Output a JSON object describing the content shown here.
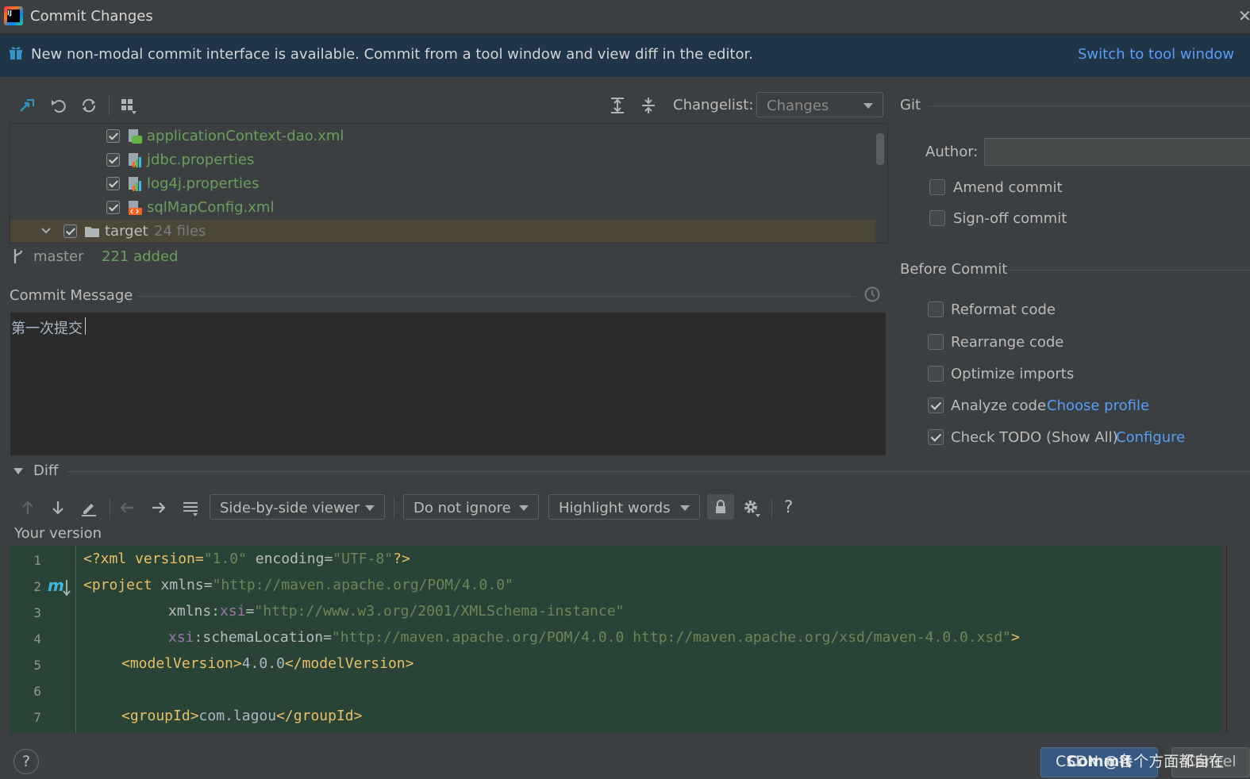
{
  "window": {
    "title": "Commit Changes"
  },
  "banner": {
    "text": "New non-modal commit interface is available. Commit from a tool window and view diff in the editor.",
    "link": "Switch to tool window"
  },
  "toolbar": {
    "changelist_label": "Changelist:",
    "changelist_value": "Changes"
  },
  "tree": {
    "files": [
      {
        "name": "applicationContext-dao.xml"
      },
      {
        "name": "jdbc.properties"
      },
      {
        "name": "log4j.properties"
      },
      {
        "name": "sqlMapConfig.xml"
      }
    ],
    "folder": {
      "name": "target",
      "count": "24 files"
    }
  },
  "status": {
    "branch": "master",
    "added": "221 added"
  },
  "commit_message": {
    "label": "Commit Message",
    "value": "第一次提交"
  },
  "git": {
    "title": "Git",
    "author_label": "Author:",
    "amend": "Amend commit",
    "signoff": "Sign-off commit"
  },
  "before_commit": {
    "title": "Before Commit",
    "reformat": "Reformat code",
    "rearrange": "Rearrange code",
    "optimize": "Optimize imports",
    "analyze": "Analyze code",
    "analyze_link": "Choose profile",
    "todo": "Check TODO (Show All)",
    "todo_link": "Configure"
  },
  "diff": {
    "title": "Diff",
    "viewer": "Side-by-side viewer",
    "ignore": "Do not ignore",
    "highlight": "Highlight words",
    "help": "?",
    "your_version": "Your version",
    "line_numbers": [
      "1",
      "2",
      "3",
      "4",
      "5",
      "6",
      "7"
    ],
    "code": {
      "l1": [
        "<?xml version=",
        "\"1.0\"",
        " encoding=",
        "\"UTF-8\"",
        "?>"
      ],
      "l2": [
        "<project ",
        "xmlns=",
        "\"http://maven.apache.org/POM/4.0.0\""
      ],
      "l3": [
        "xmlns:",
        "xsi",
        "=",
        "\"http://www.w3.org/2001/XMLSchema-instance\""
      ],
      "l4": [
        "xsi",
        ":schemaLocation=",
        "\"http://maven.apache.org/POM/4.0.0 http://maven.apache.org/xsd/maven-4.0.0.xsd\"",
        ">"
      ],
      "l5": [
        "<modelVersion>",
        "4.0.0",
        "</modelVersion>"
      ],
      "l7": [
        "<groupId>",
        "com.lagou",
        "</groupId>"
      ]
    }
  },
  "footer": {
    "help": "?",
    "commit": "Commit",
    "cancel": "Cancel",
    "watermark": "CSDN @各个方面都自在"
  }
}
